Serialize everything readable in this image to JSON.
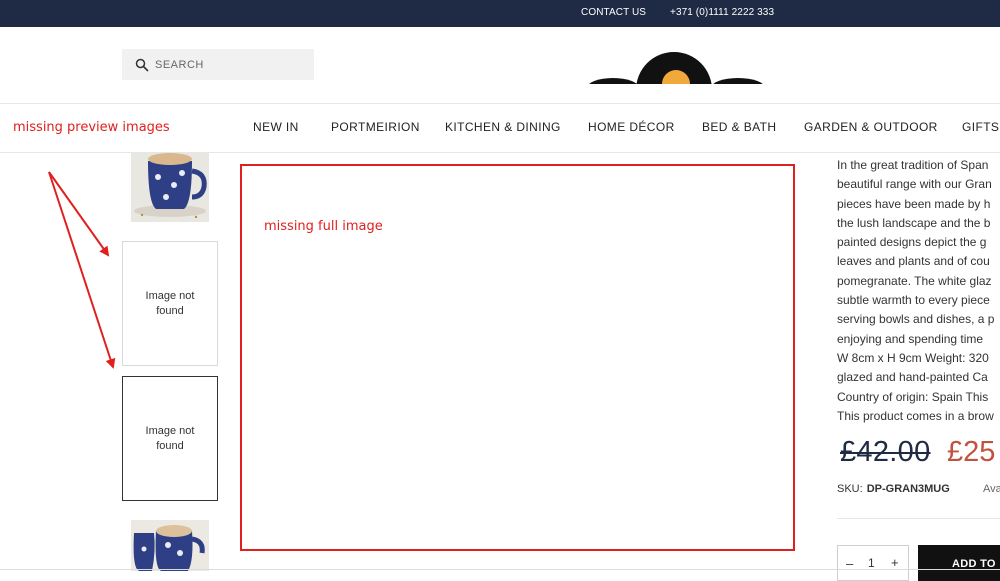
{
  "topbar": {
    "contact": "CONTACT US",
    "phone": "+371 (0)1111 2222 333"
  },
  "search": {
    "placeholder": "SEARCH"
  },
  "annotations": {
    "preview": "missing preview images",
    "full": "missing full image"
  },
  "nav": {
    "items": [
      "NEW IN",
      "PORTMEIRION",
      "KITCHEN & DINING",
      "HOME DÉCOR",
      "BED & BATH",
      "GARDEN & OUTDOOR",
      "GIFTS"
    ]
  },
  "thumbs": {
    "not_found": [
      "Image not",
      "found"
    ]
  },
  "product": {
    "description_lines": [
      "In the great tradition of Span",
      "beautiful range with our Gran",
      "pieces have been made by h",
      "the lush landscape and the b",
      "painted designs depict the g",
      "leaves and plants and of cou",
      "pomegranate. The white glaz",
      "subtle warmth to every piece",
      "serving bowls and dishes, a p",
      "enjoying and spending time",
      "W 8cm x H 9cm Weight: 320",
      "glazed and hand-painted Ca",
      "Country of origin: Spain This",
      "This product comes in a brow"
    ],
    "price_old": "£42.00",
    "price_new": "£25",
    "sku_label": "SKU:",
    "sku_value": "DP-GRAN3MUG",
    "availability": "Ava",
    "quantity": "1",
    "add_to_cart": "ADD TO"
  },
  "colors": {
    "topbar": "#1f2a44",
    "annotation": "#e0201e",
    "sale": "#c0533e"
  }
}
